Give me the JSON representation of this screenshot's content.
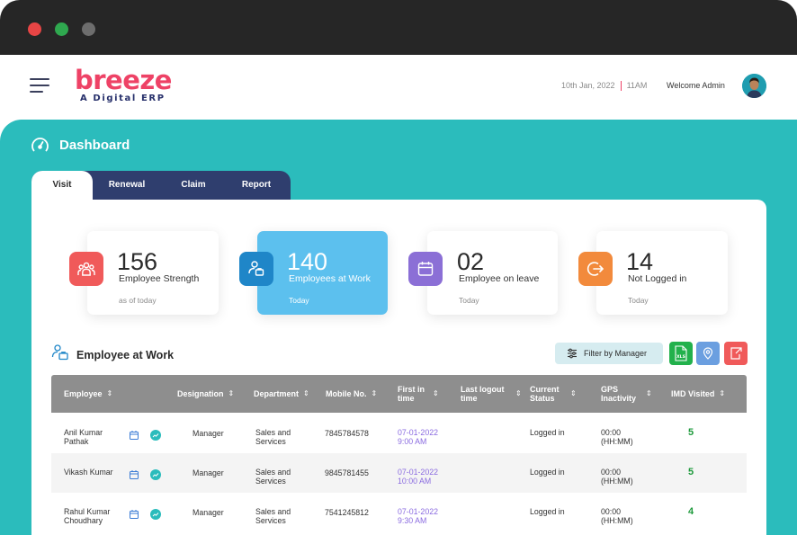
{
  "app": {
    "logo_text": "breeze",
    "tagline": "A Digital ERP",
    "date": "10th Jan, 2022",
    "time": "11AM",
    "welcome": "Welcome Admin"
  },
  "dashboard": {
    "title": "Dashboard"
  },
  "tabs": [
    {
      "label": "Visit",
      "active": true
    },
    {
      "label": "Renewal",
      "active": false
    },
    {
      "label": "Claim",
      "active": false
    },
    {
      "label": "Report",
      "active": false
    }
  ],
  "cards": [
    {
      "value": "156",
      "label": "Employee Strength",
      "sub": "as of today",
      "icon": "team-icon",
      "color": "#f05a5a"
    },
    {
      "value": "140",
      "label": "Employees at Work",
      "sub": "Today",
      "icon": "briefcase-user-icon",
      "color": "#1f86c8"
    },
    {
      "value": "02",
      "label": "Employee on leave",
      "sub": "Today",
      "icon": "calendar-icon",
      "color": "#8b6fd6"
    },
    {
      "value": "14",
      "label": "Not Logged in",
      "sub": "Today",
      "icon": "logout-icon",
      "color": "#f28a3c"
    }
  ],
  "section": {
    "title": "Employee at Work",
    "filter_label": "Filter by Manager",
    "xls_label": "XLS"
  },
  "table": {
    "headers": [
      "Employee",
      "Designation",
      "Department",
      "Mobile No.",
      "First in time",
      "Last logout time",
      "Current Status",
      "GPS Inactivity",
      "IMD Visited"
    ],
    "rows": [
      {
        "employee": "Anil Kumar Pathak",
        "designation": "Manager",
        "department": "Sales and Services",
        "mobile": "7845784578",
        "first_date": "07-01-2022",
        "first_time": "9:00 AM",
        "last_logout": "",
        "status": "Logged in",
        "gps": "00:00",
        "gps_unit": "(HH:MM)",
        "imd": "5"
      },
      {
        "employee": "Vikash Kumar",
        "designation": "Manager",
        "department": "Sales and Services",
        "mobile": "9845781455",
        "first_date": "07-01-2022",
        "first_time": "10:00 AM",
        "last_logout": "",
        "status": "Logged in",
        "gps": "00:00",
        "gps_unit": "(HH:MM)",
        "imd": "5"
      },
      {
        "employee": "Rahul Kumar Choudhary",
        "designation": "Manager",
        "department": "Sales and Services",
        "mobile": "7541245812",
        "first_date": "07-01-2022",
        "first_time": "9:30 AM",
        "last_logout": "",
        "status": "Logged in",
        "gps": "00:00",
        "gps_unit": "(HH:MM)",
        "imd": "4"
      }
    ]
  },
  "colors": {
    "brand": "#ee4266",
    "teal": "#2bbcbc",
    "navy": "#2f3e6e",
    "highlight": "#5cc0ee"
  }
}
